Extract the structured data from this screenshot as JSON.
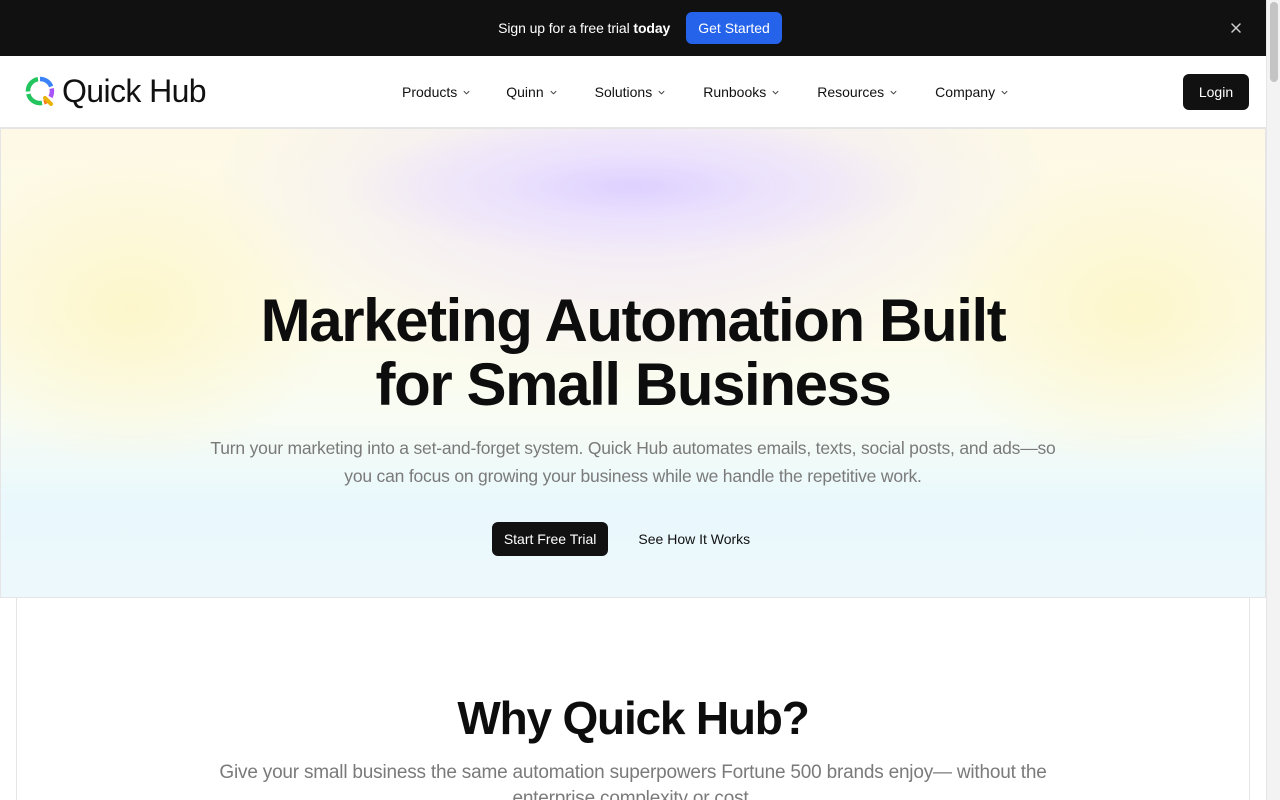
{
  "announcement": {
    "text_lead": "Sign up for a free trial ",
    "text_bold": "today",
    "cta_label": "Get Started"
  },
  "brand": {
    "name": "Quick Hub",
    "logo_colors": [
      "#22c55e",
      "#3b82f6",
      "#a855f7",
      "#f97316",
      "#eab308"
    ]
  },
  "nav": {
    "items": [
      {
        "label": "Products"
      },
      {
        "label": "Quinn"
      },
      {
        "label": "Solutions"
      },
      {
        "label": "Runbooks"
      },
      {
        "label": "Resources"
      },
      {
        "label": "Company"
      }
    ],
    "login_label": "Login"
  },
  "hero": {
    "title_line1": "Marketing Automation Built",
    "title_line2": "for Small Business",
    "subtitle": "Turn your marketing into a set-and-forget system. Quick Hub automates emails, texts, social posts, and ads—so you can focus on growing your business while we handle the repetitive work.",
    "primary_cta": "Start Free Trial",
    "secondary_cta": "See How It Works"
  },
  "why": {
    "title": "Why Quick Hub?",
    "subtitle": "Give your small business the same automation superpowers Fortune 500 brands enjoy— without the enterprise complexity or cost."
  },
  "colors": {
    "accent": "#2563eb",
    "dark": "#111111"
  }
}
